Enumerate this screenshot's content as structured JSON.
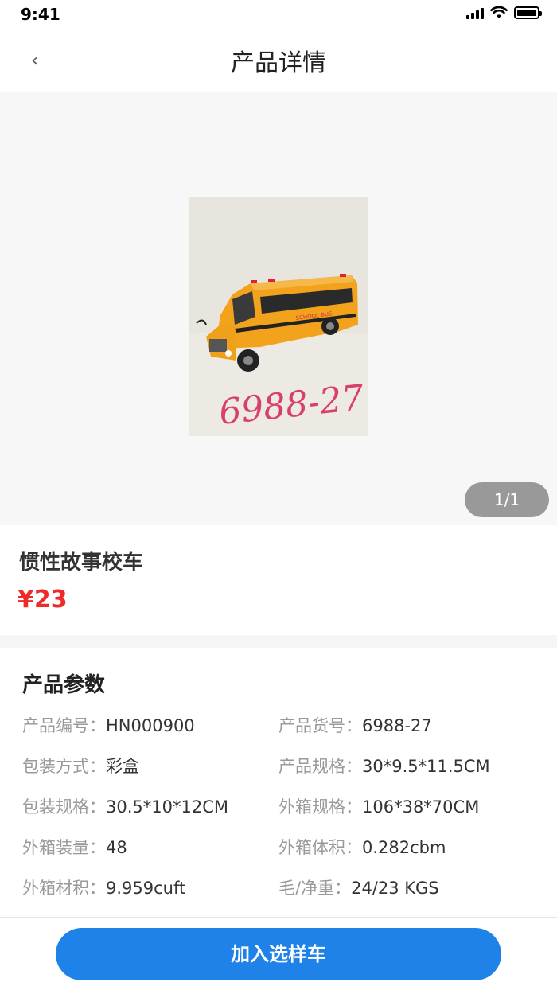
{
  "status_bar": {
    "time": "9:41"
  },
  "nav": {
    "back_icon": "‹",
    "title": "产品详情"
  },
  "gallery": {
    "pager": "1/1",
    "image_caption": "6988-27"
  },
  "product": {
    "name": "惯性故事校车",
    "price": "¥23"
  },
  "params": {
    "title": "产品参数",
    "items": [
      {
        "label": "产品编号：",
        "value": "HN000900"
      },
      {
        "label": "产品货号：",
        "value": "6988-27"
      },
      {
        "label": "包装方式：",
        "value": "彩盒"
      },
      {
        "label": "产品规格：",
        "value": "30*9.5*11.5CM"
      },
      {
        "label": "包装规格：",
        "value": "30.5*10*12CM"
      },
      {
        "label": "外箱规格：",
        "value": "106*38*70CM"
      },
      {
        "label": "外箱装量：",
        "value": "48"
      },
      {
        "label": "外箱体积：",
        "value": "0.282cbm"
      },
      {
        "label": "外箱材积：",
        "value": "9.959cuft"
      },
      {
        "label": "毛/净重：",
        "value": "24/23 KGS"
      }
    ]
  },
  "bottom": {
    "add_button": "加入选样车"
  },
  "colors": {
    "accent": "#1e82e8",
    "price": "#ee2b2b"
  }
}
